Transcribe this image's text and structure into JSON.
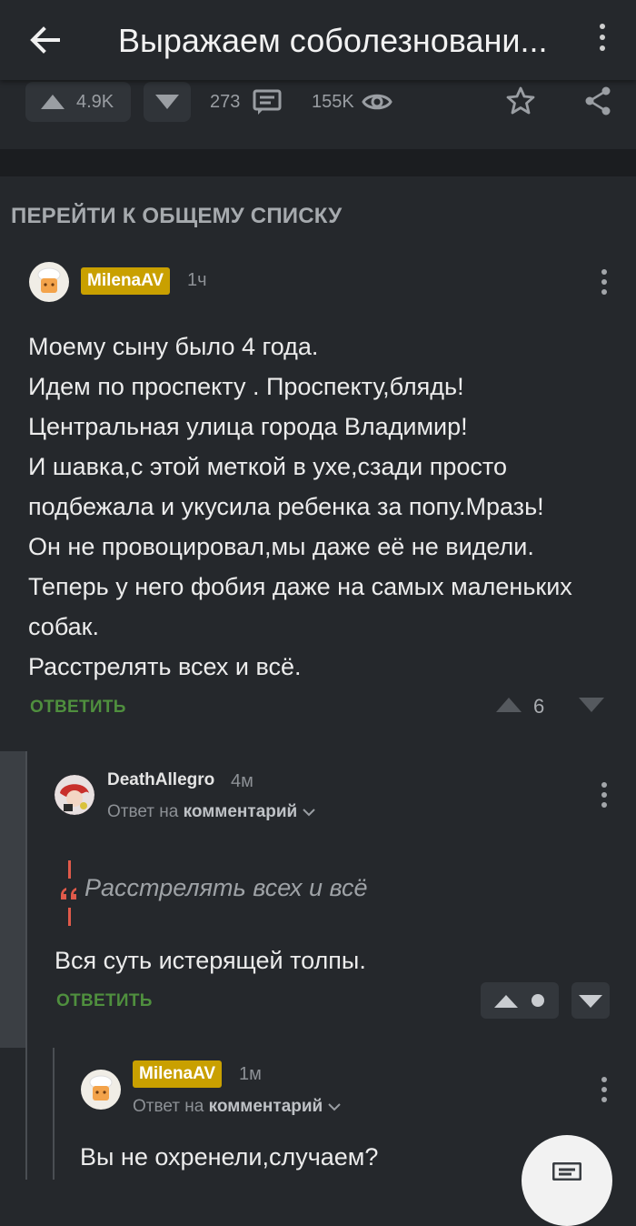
{
  "header": {
    "title": "Выражаем соболезновани...",
    "back_icon": "arrow-left-icon",
    "menu_icon": "more-vertical-icon"
  },
  "stats": {
    "rating": "4.9K",
    "comments": "273",
    "views": "155K"
  },
  "goto_list": "ПЕРЕЙТИ К ОБЩЕМУ СПИСКУ",
  "comments": [
    {
      "author": "MilenaAV",
      "time": "1ч",
      "lines": [
        "Моему сыну было 4 года.",
        "Идем по проспекту . Проспекту,блядь!",
        "Центральная улица города Владимир!",
        "И шавка,с этой меткой в ухе,сзади просто",
        "подбежала и укусила ребенка за попу.Мразь!",
        "Он не провоцировал,мы даже её не видели.",
        "Теперь у него фобия даже на самых маленьких",
        "собак.",
        "Расстрелять всех и всё."
      ],
      "reply_label": "ОТВЕТИТЬ",
      "rating": "6"
    },
    {
      "author": "DeathAllegro",
      "time": "4м",
      "reply_to_prefix": "Ответ на",
      "reply_to_target": "комментарий",
      "quote": "Расстрелять всех и всё",
      "text": "Вся суть истерящей толпы.",
      "reply_label": "ОТВЕТИТЬ"
    },
    {
      "author": "MilenaAV",
      "time": "1м",
      "reply_to_prefix": "Ответ на",
      "reply_to_target": "комментарий",
      "text": "Вы не охренели,случаем?"
    }
  ],
  "colors": {
    "background": "#25282c",
    "badge": "#c9a000",
    "reply_green": "#4f8f3e",
    "quote_mark": "#e05a4a"
  }
}
